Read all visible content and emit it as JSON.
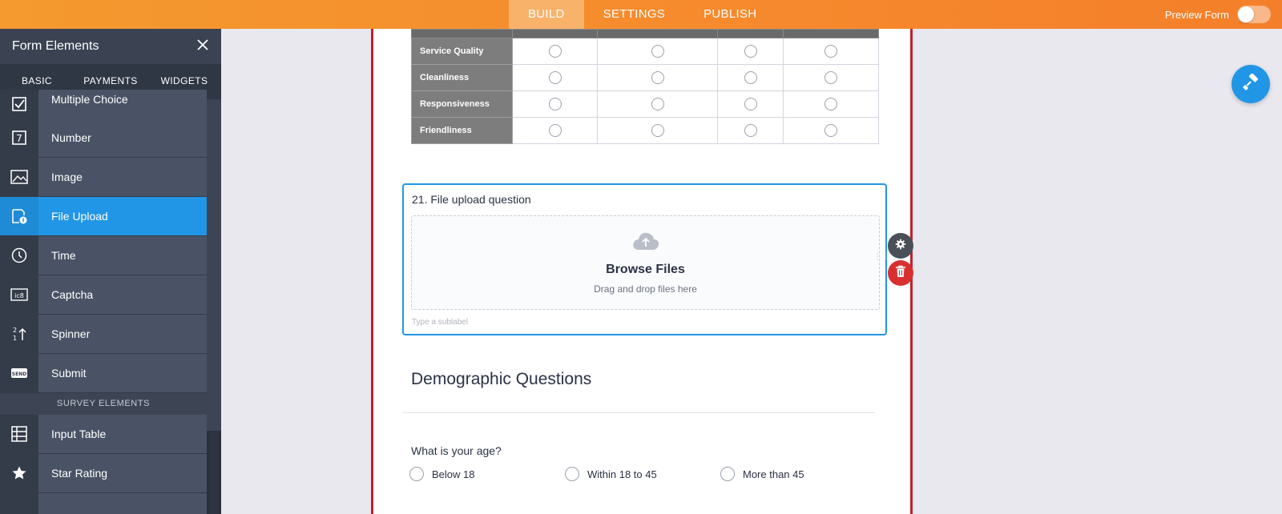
{
  "topbar": {
    "tabs": [
      {
        "label": "BUILD"
      },
      {
        "label": "SETTINGS"
      },
      {
        "label": "PUBLISH"
      }
    ],
    "active_tab": "BUILD",
    "preview_label": "Preview Form",
    "preview_enabled": false
  },
  "sidebar": {
    "title": "Form Elements",
    "tabs": [
      {
        "label": "BASIC"
      },
      {
        "label": "PAYMENTS"
      },
      {
        "label": "WIDGETS"
      }
    ],
    "active_tab": "BASIC",
    "items": [
      {
        "label": "Multiple Choice",
        "icon": "checkbox-icon"
      },
      {
        "label": "Number",
        "icon": "number-icon"
      },
      {
        "label": "Image",
        "icon": "image-icon"
      },
      {
        "label": "File Upload",
        "icon": "file-upload-icon"
      },
      {
        "label": "Time",
        "icon": "clock-icon"
      },
      {
        "label": "Captcha",
        "icon": "captcha-icon"
      },
      {
        "label": "Spinner",
        "icon": "spinner-icon"
      },
      {
        "label": "Submit",
        "icon": "send-icon"
      }
    ],
    "active_item": "File Upload",
    "section_label": "SURVEY ELEMENTS",
    "survey_items": [
      {
        "label": "Input Table",
        "icon": "table-icon"
      },
      {
        "label": "Star Rating",
        "icon": "star-icon"
      }
    ]
  },
  "matrix": {
    "rows": [
      "Service Quality",
      "Cleanliness",
      "Responsiveness",
      "Friendliness"
    ],
    "column_count": 4
  },
  "file_upload": {
    "label": "21. File upload question",
    "browse": "Browse Files",
    "drag_hint": "Drag and drop files here",
    "sublabel_placeholder": "Type a sublabel"
  },
  "demographic": {
    "title": "Demographic Questions",
    "age_question": "What is your age?",
    "age_options": [
      "Below 18",
      "Within 18 to 45",
      "More than 45"
    ]
  },
  "colors": {
    "accent": "#2296e6",
    "topbar": "#f6892d",
    "form_border": "#c3202c",
    "delete": "#d83030"
  }
}
